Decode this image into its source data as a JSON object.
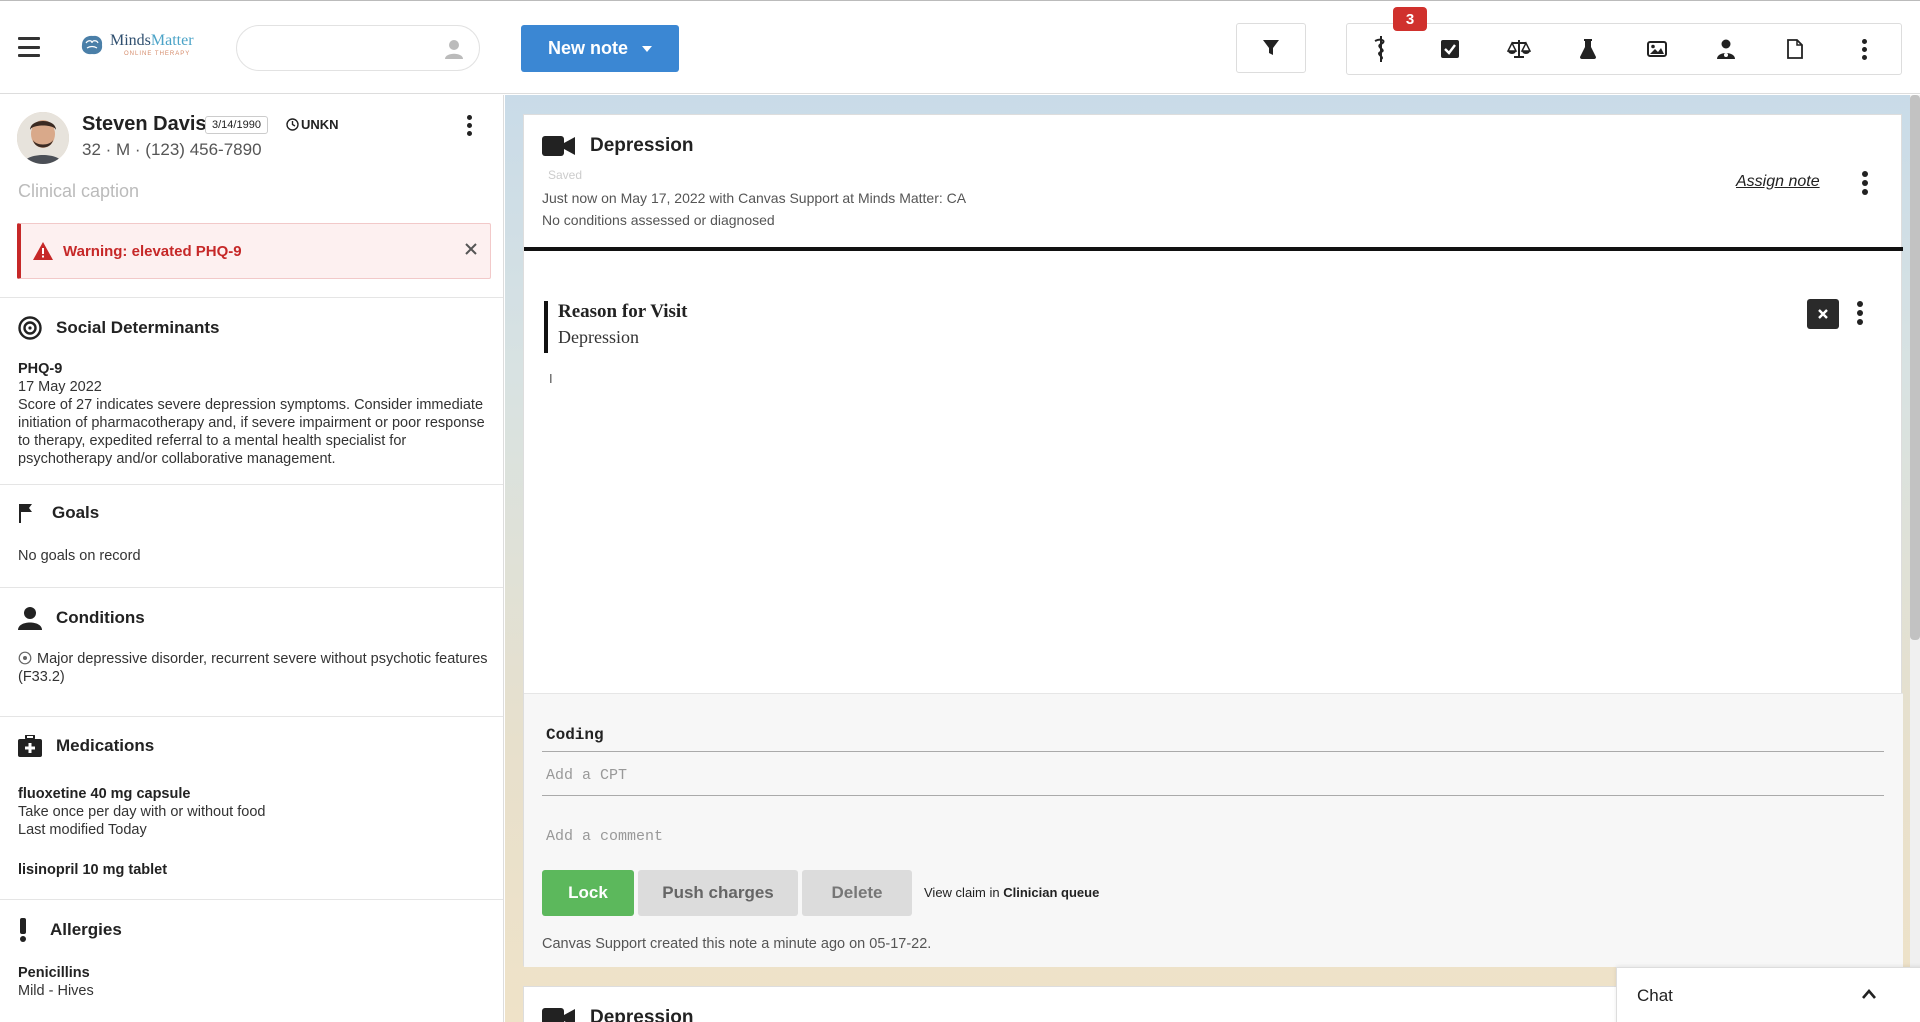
{
  "topbar": {
    "logo_name_part1": "Minds",
    "logo_name_part2": "Matter",
    "logo_subtitle": "ONLINE THERAPY",
    "search_placeholder": "",
    "new_note_label": "New note",
    "notification_count": "3"
  },
  "patient": {
    "name": "Steven Davis",
    "dob": "3/14/1990",
    "timezone": "UNKN",
    "summary": "32 · M · (123) 456-7890",
    "clinical_caption_placeholder": "Clinical caption",
    "warning": "Warning: elevated PHQ-9"
  },
  "sections": {
    "social": {
      "title": "Social Determinants",
      "item_title": "PHQ-9",
      "item_date": "17 May 2022",
      "item_text": "Score of 27 indicates severe depression symptoms. Consider immediate initiation of pharmacotherapy and, if severe impairment or poor response to therapy, expedited referral to a mental health specialist for psychotherapy and/or collaborative management."
    },
    "goals": {
      "title": "Goals",
      "empty": "No goals on record"
    },
    "conditions": {
      "title": "Conditions",
      "items": [
        "Major depressive disorder, recurrent severe without psychotic features (F33.2)"
      ]
    },
    "medications": {
      "title": "Medications",
      "items": [
        {
          "name": "fluoxetine 40 mg capsule",
          "sig": "Take once per day with or without food",
          "modified": "Last modified Today"
        },
        {
          "name": "lisinopril 10 mg tablet"
        }
      ]
    },
    "allergies": {
      "title": "Allergies",
      "items": [
        {
          "name": "Penicillins",
          "reaction": "Mild - Hives"
        }
      ]
    }
  },
  "note": {
    "title": "Depression",
    "status": "Saved",
    "meta": "Just now on May 17, 2022 with Canvas Support at Minds Matter: CA",
    "conditions": "No conditions assessed or diagnosed",
    "assign_label": "Assign note",
    "rfv_title": "Reason for Visit",
    "rfv_value": "Depression",
    "coding_title": "Coding",
    "cpt_placeholder": "Add a CPT",
    "comment_placeholder": "Add a comment",
    "lock_label": "Lock",
    "push_label": "Push charges",
    "delete_label": "Delete",
    "view_claim_prefix": "View claim in",
    "view_claim_link": "Clinician queue",
    "created_by": "Canvas Support created this note a minute ago on 05-17-22."
  },
  "note2": {
    "title": "Depression"
  },
  "chat": {
    "label": "Chat"
  },
  "colors": {
    "primary": "#3b87d3",
    "lock": "#5cb85c",
    "warning": "#c62828",
    "badge": "#d0312d"
  },
  "icons": {
    "toolbar": [
      "filter-icon",
      "caduceus-icon",
      "checkbox-icon",
      "scale-icon",
      "flask-icon",
      "image-icon",
      "doctor-icon",
      "document-icon",
      "more-vertical-icon"
    ]
  }
}
